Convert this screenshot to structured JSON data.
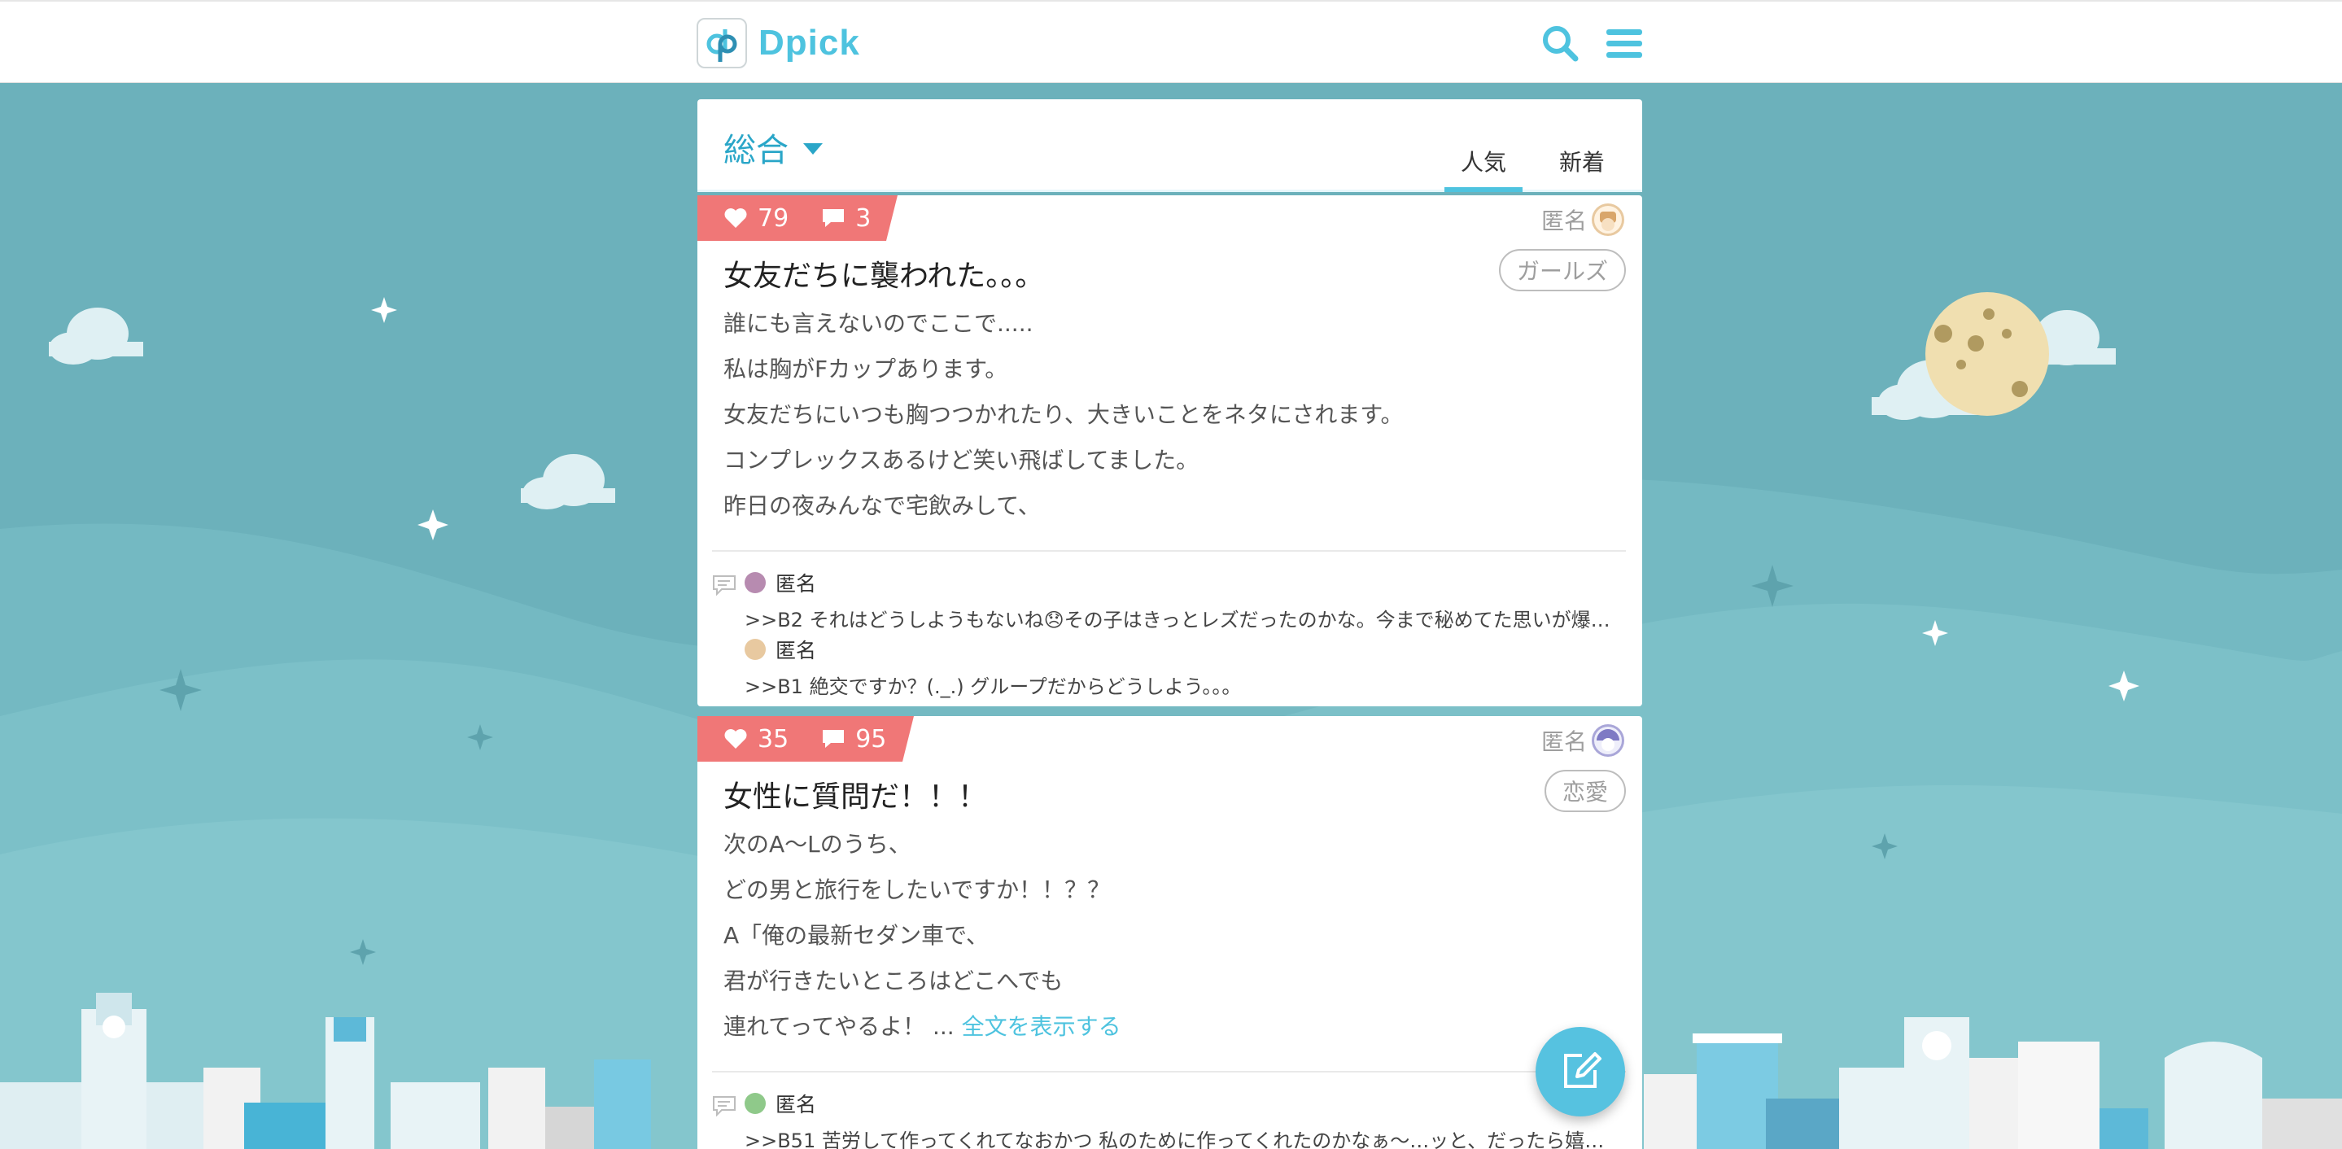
{
  "app": {
    "name": "Dpick",
    "accent": "#4ec3df",
    "badge_color": "#f07777"
  },
  "header": {
    "search_icon": "search-icon",
    "menu_icon": "hamburger-menu-icon"
  },
  "category": {
    "selected": "総合"
  },
  "tabs": [
    {
      "label": "人気",
      "active": true
    },
    {
      "label": "新着",
      "active": false
    }
  ],
  "posts": [
    {
      "likes": "79",
      "comments": "3",
      "author": "匿名",
      "title": "女友だちに襲われた。。。",
      "tag": "ガールズ",
      "lines": [
        "誰にも言えないのでここで.....",
        "私は胸がFカップあります。",
        "女友だちにいつも胸つつかれたり、大きいことをネタにされます。",
        "コンプレックスあるけど笑い飛ばしてました。",
        "昨日の夜みんなで宅飲みして、"
      ],
      "replies": [
        {
          "author": "匿名",
          "text": ">>B2 それはどうしようもないね😞その子はきっとレズだったのかな。今まで秘めてた思いが爆発…"
        },
        {
          "author": "匿名",
          "text": ">>B1 絶交ですか？(._.) グループだからどうしよう。。。"
        }
      ]
    },
    {
      "likes": "35",
      "comments": "95",
      "author": "匿名",
      "title": "女性に質問だ！！！",
      "tag": "恋愛",
      "lines": [
        "次のA〜Lのうち、",
        "どの男と旅行をしたいですか！！？？",
        "A「俺の最新セダン車で、",
        "君が行きたいところはどこへでも",
        "連れてってやるよ！ ..."
      ],
      "more_label": "全文を表示する",
      "replies": [
        {
          "author": "匿名",
          "text": ">>B51 苦労して作ってくれてなおかつ 私のために作ってくれたのかなぁ〜…ッと、だったら嬉し…"
        }
      ]
    }
  ],
  "fab": {
    "icon": "compose-icon"
  }
}
